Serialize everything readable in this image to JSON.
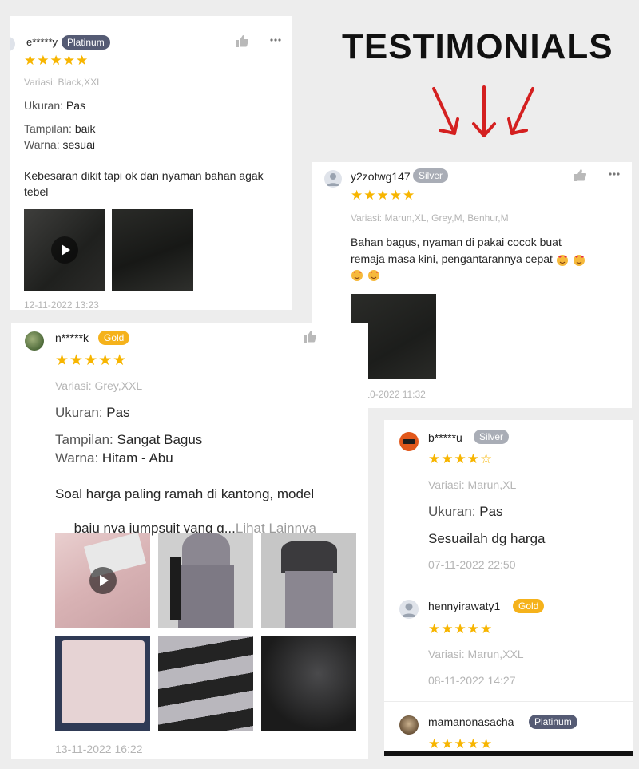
{
  "title": "TESTIMONIALS",
  "colors": {
    "star": "#f7b500",
    "platinum": "#555b74",
    "silver": "#a9adb6",
    "gold": "#f5b21b"
  },
  "review1": {
    "user": "e*****y",
    "badge": "Platinum",
    "stars": "★★★★★",
    "variation": "Variasi: Black,XXL",
    "size_label": "Ukuran:",
    "size_value": "Pas",
    "look_label": "Tampilan:",
    "look_value": "baik",
    "color_label": "Warna:",
    "color_value": "sesuai",
    "comment_line1": "Kebesaran dikit tapi ok dan nyaman bahan agak",
    "comment_line2": "tebel",
    "date": "12-11-2022 13:23"
  },
  "review2": {
    "user": "y2zotwg147",
    "badge": "Silver",
    "stars": "★★★★★",
    "variation": "Variasi: Marun,XL, Grey,M, Benhur,M",
    "comment_line1": "Bahan bagus, nyaman di pakai cocok buat",
    "comment_line2": "remaja masa kini, pengantarannya cepat",
    "date": "06-10-2022 11:32"
  },
  "review3": {
    "user": "n*****k",
    "badge": "Gold",
    "stars": "★★★★★",
    "variation": "Variasi: Grey,XXL",
    "size_label": "Ukuran:",
    "size_value": "Pas",
    "look_label": "Tampilan:",
    "look_value": "Sangat Bagus",
    "color_label": "Warna:",
    "color_value": "Hitam - Abu",
    "comment_line1": "Soal harga paling ramah di kantong, model",
    "comment_line2": " baju nya jumpsuit yang g...",
    "see_more": "Lihat Lainnya",
    "date": "13-11-2022 16:22"
  },
  "review4": {
    "user": "b*****u",
    "badge": "Silver",
    "stars": "★★★★",
    "empty_star": "☆",
    "variation": "Variasi: Marun,XL",
    "size_label": "Ukuran:",
    "size_value": "Pas",
    "comment": "Sesuailah dg harga",
    "date": "07-11-2022 22:50"
  },
  "review5": {
    "user": "hennyirawaty1",
    "badge": "Gold",
    "stars": "★★★★★",
    "variation": "Variasi: Marun,XXL",
    "date": "08-11-2022 14:27"
  },
  "review6": {
    "user": "mamanonasacha",
    "badge": "Platinum",
    "stars": "★★★★★"
  }
}
